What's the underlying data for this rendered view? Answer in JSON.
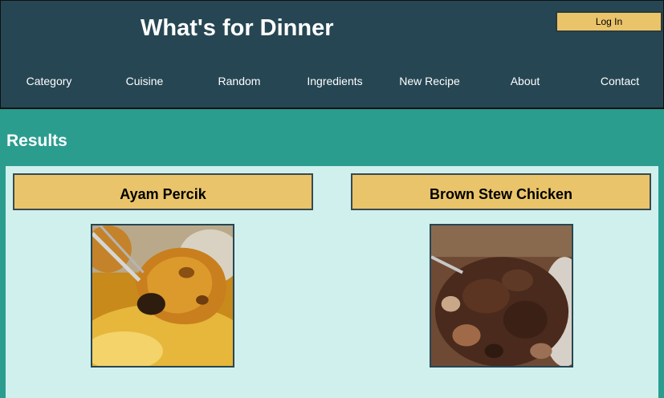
{
  "header": {
    "title": "What's for Dinner",
    "login_label": "Log In"
  },
  "nav": {
    "items": [
      {
        "label": "Category"
      },
      {
        "label": "Cuisine"
      },
      {
        "label": "Random"
      },
      {
        "label": "Ingredients"
      },
      {
        "label": "New Recipe"
      },
      {
        "label": "About"
      },
      {
        "label": "Contact"
      }
    ]
  },
  "results": {
    "title": "Results",
    "cards": [
      {
        "name": "Ayam Percik"
      },
      {
        "name": "Brown Stew Chicken"
      }
    ]
  },
  "colors": {
    "header_bg": "#264653",
    "page_bg": "#2a9d8f",
    "accent": "#e9c46a",
    "panel_bg": "#d0f0ee"
  }
}
